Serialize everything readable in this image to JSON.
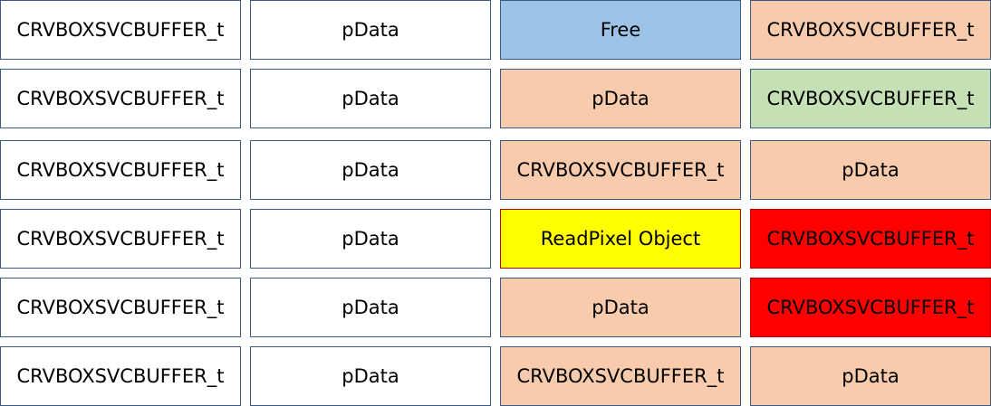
{
  "colors": {
    "white": "#ffffff",
    "free_blue": "#9dc3e6",
    "peach": "#f8cbad",
    "green": "#c5e0b4",
    "yellow": "#ffff00",
    "red": "#ff0000",
    "border": "#3a5a86"
  },
  "rows": [
    [
      "CRVBOXSVCBUFFER_t",
      "pData",
      "Free",
      "CRVBOXSVCBUFFER_t"
    ],
    [
      "CRVBOXSVCBUFFER_t",
      "pData",
      "pData",
      "CRVBOXSVCBUFFER_t"
    ],
    [
      "CRVBOXSVCBUFFER_t",
      "pData",
      "CRVBOXSVCBUFFER_t",
      "pData"
    ],
    [
      "CRVBOXSVCBUFFER_t",
      "pData",
      "ReadPixel Object",
      "CRVBOXSVCBUFFER_t"
    ],
    [
      "CRVBOXSVCBUFFER_t",
      "pData",
      "pData",
      "CRVBOXSVCBUFFER_t"
    ],
    [
      "CRVBOXSVCBUFFER_t",
      "pData",
      "CRVBOXSVCBUFFER_t",
      "pData"
    ]
  ]
}
